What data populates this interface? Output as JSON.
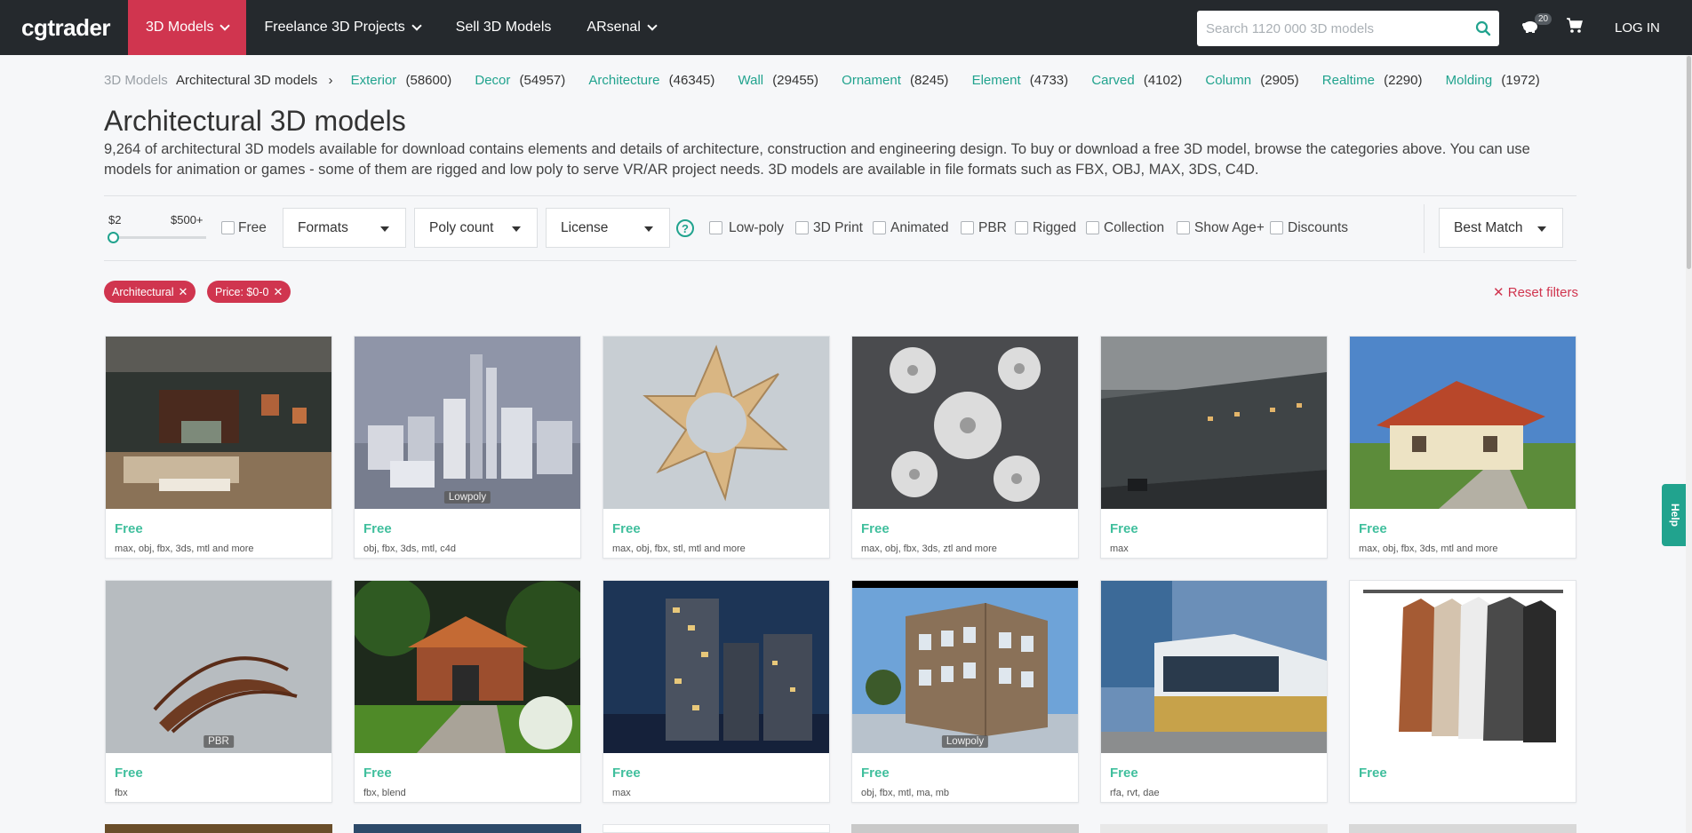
{
  "header": {
    "logo": "cgtrader",
    "nav": [
      {
        "label": "3D Models",
        "active": true
      },
      {
        "label": "Freelance 3D Projects",
        "active": false
      },
      {
        "label": "Sell 3D Models",
        "active": false
      },
      {
        "label": "ARsenal",
        "active": false
      }
    ],
    "search_placeholder": "Search 1120 000 3D models",
    "notif_count": "20",
    "login": "LOG IN",
    "accent": "#d0354f"
  },
  "breadcrumb": {
    "root": "3D Models",
    "current": "Architectural 3D models",
    "categories": [
      {
        "name": "Exterior",
        "count": "(58600)"
      },
      {
        "name": "Decor",
        "count": "(54957)"
      },
      {
        "name": "Architecture",
        "count": "(46345)"
      },
      {
        "name": "Wall",
        "count": "(29455)"
      },
      {
        "name": "Ornament",
        "count": "(8245)"
      },
      {
        "name": "Element",
        "count": "(4733)"
      },
      {
        "name": "Carved",
        "count": "(4102)"
      },
      {
        "name": "Column",
        "count": "(2905)"
      },
      {
        "name": "Realtime",
        "count": "(2290)"
      },
      {
        "name": "Molding",
        "count": "(1972)"
      }
    ]
  },
  "page": {
    "title": "Architectural 3D models",
    "description": "9,264 of architectural 3D models available for download contains elements and details of architecture, construction and engineering design. To buy or download a free 3D model, browse the categories above. You can use models for animation or games - some of them are rigged and low poly to serve VR/AR project needs. 3D models are available in file formats such as FBX, OBJ, MAX, 3DS, C4D."
  },
  "filters": {
    "price_min": "$2",
    "price_max": "$500+",
    "free": "Free",
    "formats": "Formats",
    "poly_count": "Poly count",
    "license": "License",
    "help": "?",
    "checkboxes": [
      "Low-poly",
      "3D Print",
      "Animated",
      "PBR",
      "Rigged",
      "Collection",
      "Show Age+",
      "Discounts"
    ],
    "sort": "Best Match"
  },
  "active_filters": [
    {
      "label": "Architectural"
    },
    {
      "label": "Price: $0-0"
    }
  ],
  "reset_filters": "Reset filters",
  "products": [
    {
      "price": "Free",
      "formats": "max, obj, fbx, 3ds, mtl and more",
      "tag": "",
      "thumb": "living-room"
    },
    {
      "price": "Free",
      "formats": "obj, fbx, 3ds, mtl, c4d",
      "tag": "Lowpoly",
      "thumb": "city"
    },
    {
      "price": "Free",
      "formats": "max, obj, fbx, stl, mtl and more",
      "tag": "",
      "thumb": "gold-star-ornament"
    },
    {
      "price": "Free",
      "formats": "max, obj, fbx, 3ds, ztl and more",
      "tag": "",
      "thumb": "flowers-relief"
    },
    {
      "price": "Free",
      "formats": "max",
      "tag": "",
      "thumb": "apartments-street"
    },
    {
      "price": "Free",
      "formats": "max, obj, fbx, 3ds, mtl and more",
      "tag": "",
      "thumb": "house-red-roof"
    },
    {
      "price": "Free",
      "formats": "fbx",
      "tag": "PBR",
      "thumb": "wooden-bridge"
    },
    {
      "price": "Free",
      "formats": "fbx, blend",
      "tag": "",
      "thumb": "brick-cottage"
    },
    {
      "price": "Free",
      "formats": "max",
      "tag": "",
      "thumb": "night-towers"
    },
    {
      "price": "Free",
      "formats": "obj, fbx, mtl, ma, mb",
      "tag": "Lowpoly",
      "thumb": "corner-building"
    },
    {
      "price": "Free",
      "formats": "rfa, rvt, dae",
      "tag": "",
      "thumb": "modern-building"
    },
    {
      "price": "Free",
      "formats": "",
      "tag": "",
      "thumb": "hanging-clothes"
    }
  ],
  "help_tab": "Help"
}
